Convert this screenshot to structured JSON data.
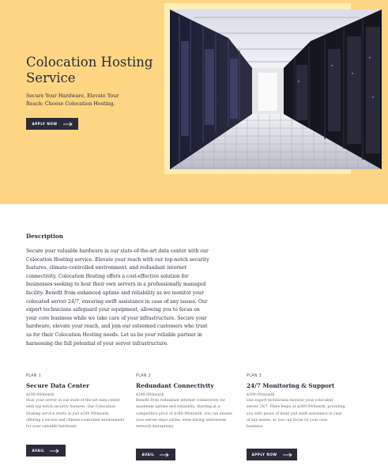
{
  "hero": {
    "title": "Colocation Hosting Service",
    "subtitle": "Secure Your Hardware, Elevate Your Reach: Choose Colocation Hosting.",
    "button_label": "APPLY NOW",
    "background_color": "#fed683",
    "image_alt": "server-room-photo"
  },
  "description": {
    "heading": "Description",
    "body": "Secure your valuable hardware in our state-of-the-art data center with our Colocation Hosting service. Elevate your reach with our top-notch security features, climate-controlled environment, and redundant internet connectivity. Colocation Hosting offers a cost-effective solution for businesses seeking to host their own servers in a professionally managed facility. Benefit from enhanced uptime and reliability as we monitor your colocated server 24/7, ensuring swift assistance in case of any issues. Our expert technicians safeguard your equipment, allowing you to focus on your core business while we take care of your infrastructure. Secure your hardware, elevate your reach, and join our esteemed customers who trust us for their Colocation Hosting needs. Let us be your reliable partner in harnessing the full potential of your server infrastructure."
  },
  "plans": [
    {
      "number": "PLAN 1",
      "title": "Secure Data Center",
      "price": "$299.99/month",
      "text": "Host your server in our state-of-the-art data center with top notch security features. Our Colocation Hosting service starts at just $299.99/month, offering a secure and climate-controlled environment for your valuable hardware.",
      "button_label": "AVAIL"
    },
    {
      "number": "PLAN 2",
      "title": "Redundant Connectivity",
      "price": "$349.99/month",
      "text": "Benefit from redundant internet connectivity for maximum uptime and reliability. Starting at a competitive price of $349.99/month, you can ensure your server stays online, even during unforeseen network disruptions.",
      "button_label": "AVAIL"
    },
    {
      "number": "PLAN 3",
      "title": "24/7 Monitoring & Support",
      "price": "$399.99/month",
      "text": "Our expert technicians monitor your colocated server 24/7. Plans begin at $399.99/month, providing you with peace of mind and swift assistance in case of any issues, so you can focus on your core business.",
      "button_label": "APPLY NOW"
    }
  ]
}
